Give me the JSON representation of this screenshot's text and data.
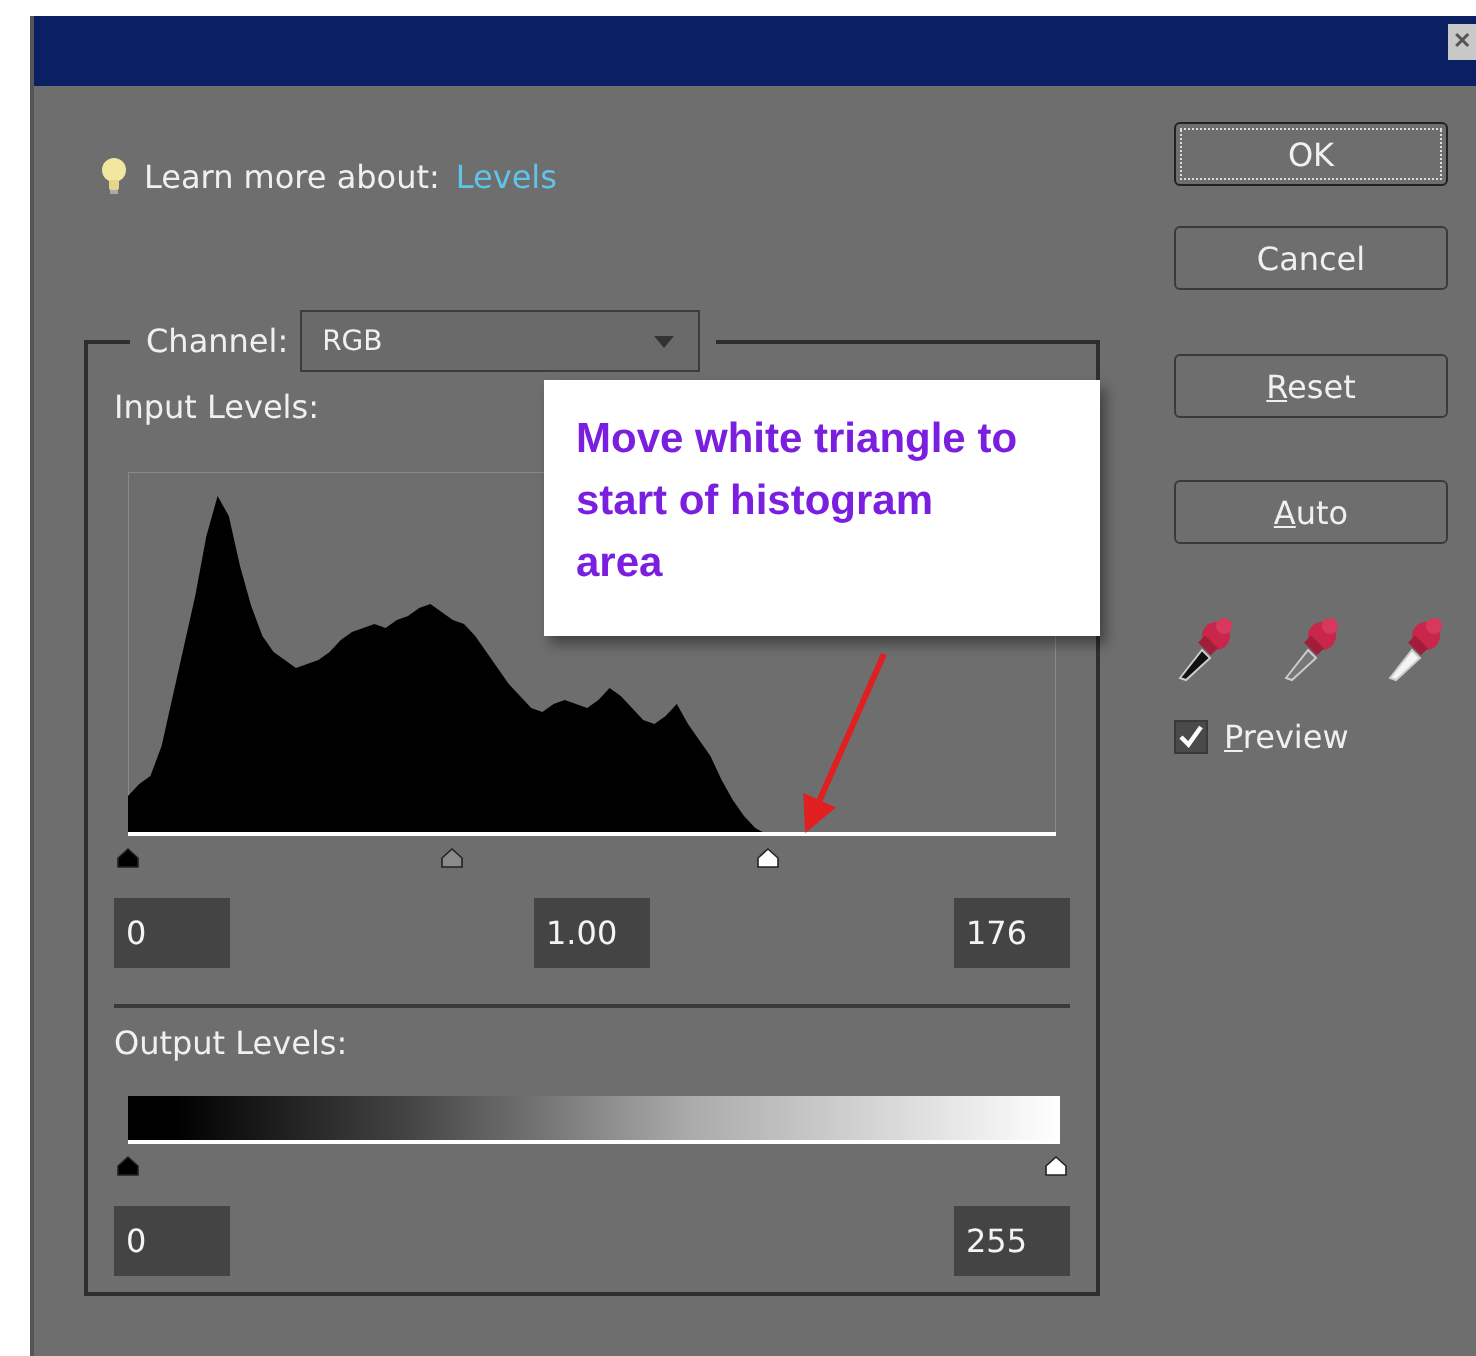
{
  "window": {
    "title_bar": {
      "close": "✕"
    }
  },
  "learn_more": {
    "label": "Learn more about:",
    "link": "Levels"
  },
  "channel": {
    "label": "Channel:",
    "value": "RGB"
  },
  "input_levels": {
    "label": "Input Levels:",
    "thumbs": [
      {
        "kind": "black",
        "level": 0
      },
      {
        "kind": "gray",
        "level": 0.35
      },
      {
        "kind": "white",
        "level": 0.69
      }
    ],
    "fields": [
      "0",
      "1.00",
      "176"
    ]
  },
  "output_levels": {
    "label": "Output Levels:",
    "thumbs": [
      {
        "kind": "black",
        "level": 0
      },
      {
        "kind": "white",
        "level": 1
      }
    ],
    "fields": [
      "0",
      "255"
    ]
  },
  "buttons": [
    {
      "label": "OK",
      "default": true,
      "mnemonic_first": false
    },
    {
      "label": "Cancel",
      "default": false,
      "mnemonic_first": false
    },
    {
      "label": "Reset",
      "default": false,
      "mnemonic_first": true
    },
    {
      "label": "Auto",
      "default": false,
      "mnemonic_first": true
    }
  ],
  "eyedroppers": [
    {
      "kind": "black"
    },
    {
      "kind": "gray"
    },
    {
      "kind": "white"
    }
  ],
  "preview": {
    "label": "Preview",
    "checked": true,
    "mnemonic_first": true
  },
  "callout": {
    "text": "Move white triangle to start of histogram area"
  }
}
